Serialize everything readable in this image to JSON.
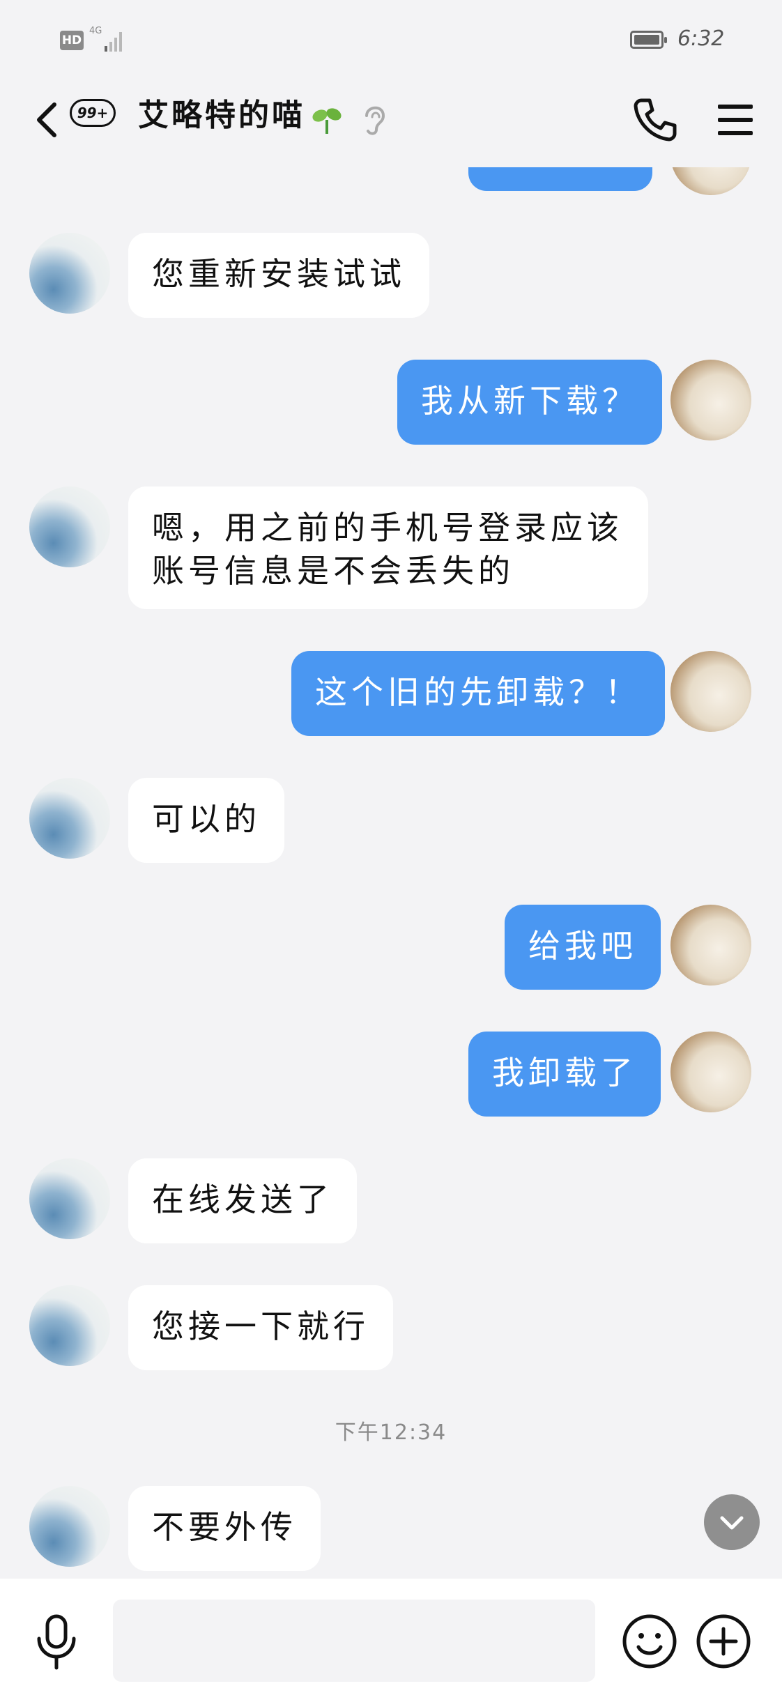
{
  "status_bar": {
    "hd": "HD",
    "network": "4G",
    "time": "6:32"
  },
  "header": {
    "badge": "99+",
    "title": "艾略特的喵"
  },
  "messages": [
    {
      "side": "in",
      "text": "您重新安装试试"
    },
    {
      "side": "out",
      "text": "我从新下载？"
    },
    {
      "side": "in",
      "lines": [
        "嗯，用之前的手机号登录应该",
        "账号信息是不会丢失的"
      ]
    },
    {
      "side": "out",
      "text": "这个旧的先卸载？！"
    },
    {
      "side": "in",
      "text": "可以的"
    },
    {
      "side": "out",
      "text": "给我吧"
    },
    {
      "side": "out",
      "text": "我卸载了"
    },
    {
      "side": "in",
      "text": "在线发送了"
    },
    {
      "side": "in",
      "text": "您接一下就行"
    },
    {
      "side": "in",
      "text": "不要外传"
    }
  ],
  "timestamp": "下午12:34",
  "input": {
    "placeholder": ""
  },
  "colors": {
    "outgoing_bubble": "#4a97f2",
    "incoming_bubble": "#ffffff",
    "background": "#f3f3f5"
  },
  "icons": [
    "back-icon",
    "sprout-icon",
    "ear-icon",
    "phone-icon",
    "menu-icon",
    "chevron-down-icon",
    "mic-icon",
    "emoji-icon",
    "plus-icon"
  ]
}
